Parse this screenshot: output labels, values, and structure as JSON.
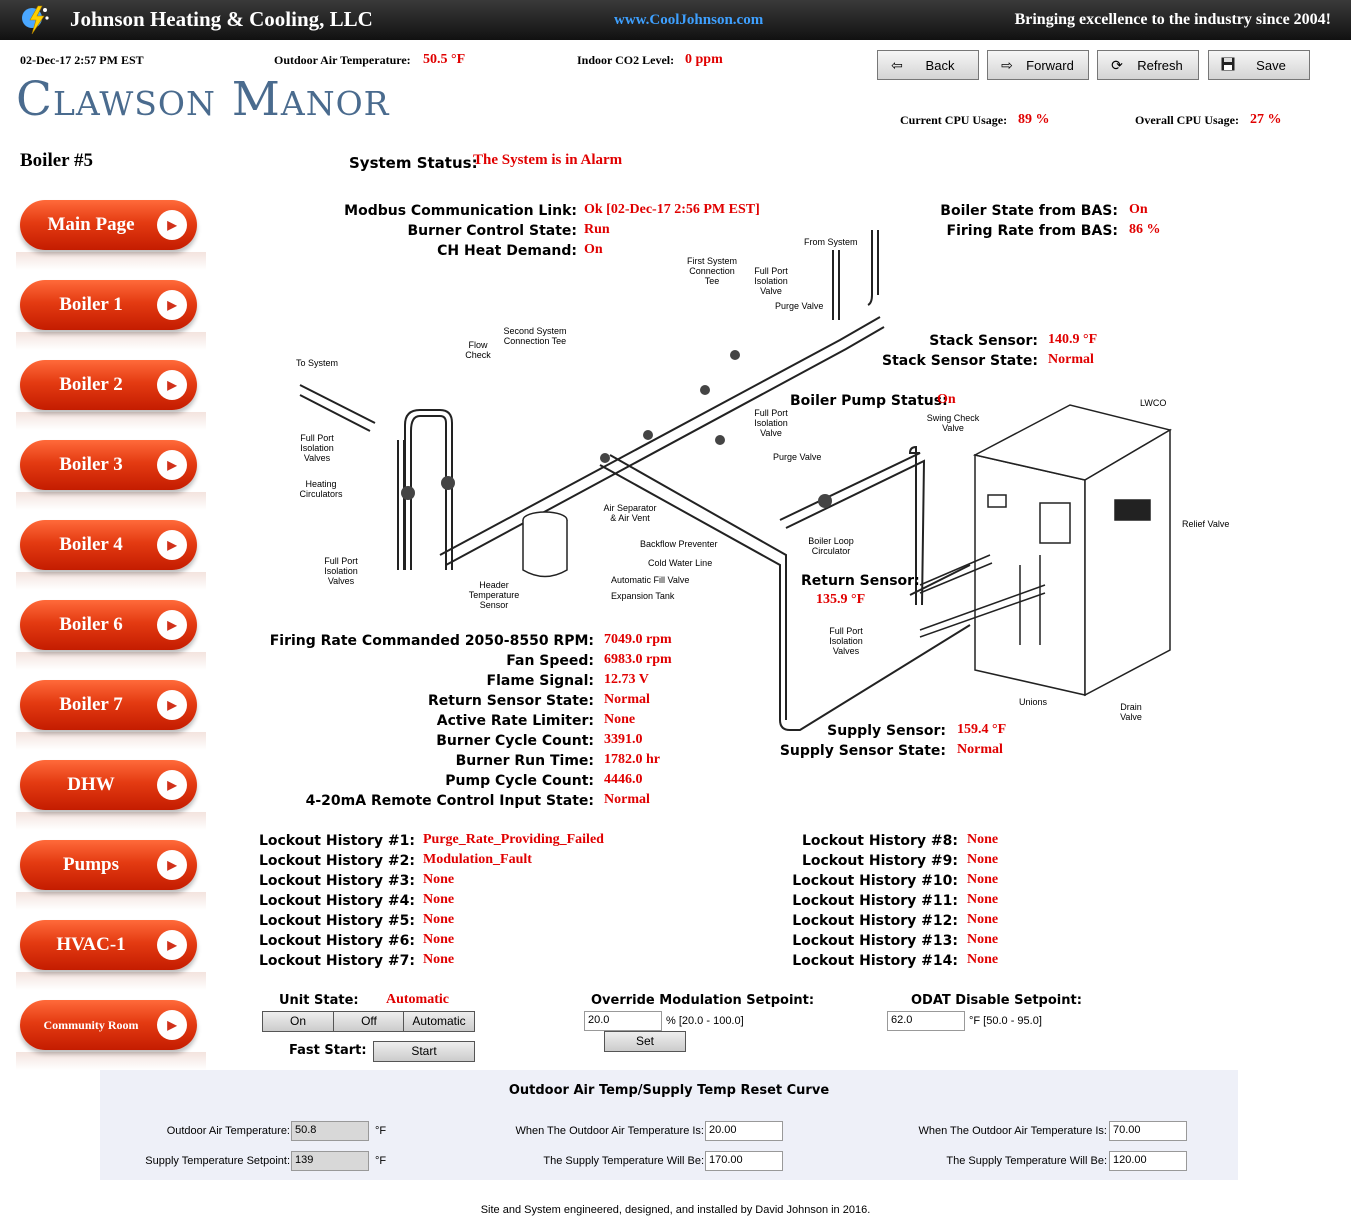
{
  "header": {
    "company": "Johnson Heating & Cooling, LLC",
    "url": "www.CoolJohnson.com",
    "tagline": "Bringing excellence to the industry since 2004!",
    "datetime": "02-Dec-17 2:57 PM EST",
    "oat_label": "Outdoor Air Temperature:",
    "oat_value": "50.5 °F",
    "co2_label": "Indoor CO2 Level:",
    "co2_value": "0 ppm",
    "site_name": "Clawson Manor",
    "cpu_current_label": "Current CPU Usage:",
    "cpu_current_value": "89 %",
    "cpu_overall_label": "Overall CPU Usage:",
    "cpu_overall_value": "27 %"
  },
  "toolbar": {
    "back": "Back",
    "forward": "Forward",
    "refresh": "Refresh",
    "save": "Save"
  },
  "sidebar": {
    "title": "Boiler #5",
    "items": [
      "Main Page",
      "Boiler 1",
      "Boiler 2",
      "Boiler 3",
      "Boiler 4",
      "Boiler 6",
      "Boiler 7",
      "DHW",
      "Pumps",
      "HVAC-1",
      "Community Room"
    ]
  },
  "status": {
    "system_label": "System Status:",
    "system_value": "The System is in Alarm",
    "modbus_label": "Modbus Communication Link:",
    "modbus_value": "Ok [02-Dec-17 2:56 PM EST]",
    "burner_state_label": "Burner Control State:",
    "burner_state_value": "Run",
    "ch_demand_label": "CH Heat Demand:",
    "ch_demand_value": "On",
    "bas_state_label": "Boiler State from BAS:",
    "bas_state_value": "On",
    "bas_rate_label": "Firing Rate from BAS:",
    "bas_rate_value": "86 %",
    "stack_label": "Stack Sensor:",
    "stack_value": "140.9 °F",
    "stack_state_label": "Stack Sensor State:",
    "stack_state_value": "Normal",
    "pump_label": "Boiler Pump Status:",
    "pump_value": "On",
    "return_label": "Return Sensor:",
    "return_value": "135.9 °F",
    "supply_label": "Supply Sensor:",
    "supply_value": "159.4 °F",
    "supply_state_label": "Supply Sensor State:",
    "supply_state_value": "Normal"
  },
  "metrics": [
    {
      "label": "Firing Rate Commanded 2050-8550 RPM:",
      "value": "7049.0 rpm"
    },
    {
      "label": "Fan Speed:",
      "value": "6983.0 rpm"
    },
    {
      "label": "Flame Signal:",
      "value": "12.73 V"
    },
    {
      "label": "Return Sensor State:",
      "value": "Normal"
    },
    {
      "label": "Active Rate Limiter:",
      "value": "None"
    },
    {
      "label": "Burner Cycle Count:",
      "value": "3391.0"
    },
    {
      "label": "Burner Run Time:",
      "value": "1782.0 hr"
    },
    {
      "label": "Pump Cycle Count:",
      "value": "4446.0"
    },
    {
      "label": "4-20mA Remote Control Input State:",
      "value": "Normal"
    }
  ],
  "lockouts_left": [
    {
      "label": "Lockout History #1:",
      "value": "Purge_Rate_Providing_Failed"
    },
    {
      "label": "Lockout History #2:",
      "value": "Modulation_Fault"
    },
    {
      "label": "Lockout History #3:",
      "value": "None"
    },
    {
      "label": "Lockout History #4:",
      "value": "None"
    },
    {
      "label": "Lockout History #5:",
      "value": "None"
    },
    {
      "label": "Lockout History #6:",
      "value": "None"
    },
    {
      "label": "Lockout History #7:",
      "value": "None"
    }
  ],
  "lockouts_right": [
    {
      "label": "Lockout History #8:",
      "value": "None"
    },
    {
      "label": "Lockout History #9:",
      "value": "None"
    },
    {
      "label": "Lockout History #10:",
      "value": "None"
    },
    {
      "label": "Lockout History #11:",
      "value": "None"
    },
    {
      "label": "Lockout History #12:",
      "value": "None"
    },
    {
      "label": "Lockout History #13:",
      "value": "None"
    },
    {
      "label": "Lockout History #14:",
      "value": "None"
    }
  ],
  "controls": {
    "unit_state_label": "Unit State:",
    "unit_state_value": "Automatic",
    "on": "On",
    "off": "Off",
    "automatic": "Automatic",
    "fast_start_label": "Fast Start:",
    "start": "Start",
    "override_label": "Override Modulation Setpoint:",
    "override_value": "20.0",
    "override_range": "% [20.0 - 100.0]",
    "set": "Set",
    "odat_label": "ODAT Disable Setpoint:",
    "odat_value": "62.0",
    "odat_range": "°F [50.0 - 95.0]"
  },
  "curve": {
    "title": "Outdoor Air Temp/Supply Temp Reset Curve",
    "oat_label": "Outdoor Air Temperature:",
    "oat_value": "50.8",
    "unit": "°F",
    "sts_label": "Supply Temperature Setpoint:",
    "sts_value": "139",
    "when1_label": "When The Outdoor Air Temperature Is:",
    "when1_value": "20.00",
    "will1_label": "The Supply Temperature Will Be:",
    "will1_value": "170.00",
    "when2_label": "When The Outdoor Air Temperature Is:",
    "when2_value": "70.00",
    "will2_label": "The Supply Temperature Will Be:",
    "will2_value": "120.00"
  },
  "diagram": {
    "labels": [
      "To System",
      "Flow Check",
      "Full Port Isolation Valves",
      "Heating Circulators",
      "Full Port Isolation Valves",
      "Header Temperature Sensor",
      "Second System Connection Tee",
      "First System Connection Tee",
      "Full Port Isolation Valve",
      "From System",
      "Purge Valve",
      "Full Port Isolation Valve",
      "Purge Valve",
      "Air Separator & Air Vent",
      "Backflow Preventer",
      "Cold Water Line",
      "Automatic Fill Valve",
      "Expansion Tank",
      "Swing Check Valve",
      "Boiler Loop Circulator",
      "LWCO",
      "Relief Valve",
      "Full Port Isolation Valves",
      "Unions",
      "Drain Valve"
    ]
  },
  "footer": "Site and System engineered, designed, and installed by David Johnson in 2016."
}
